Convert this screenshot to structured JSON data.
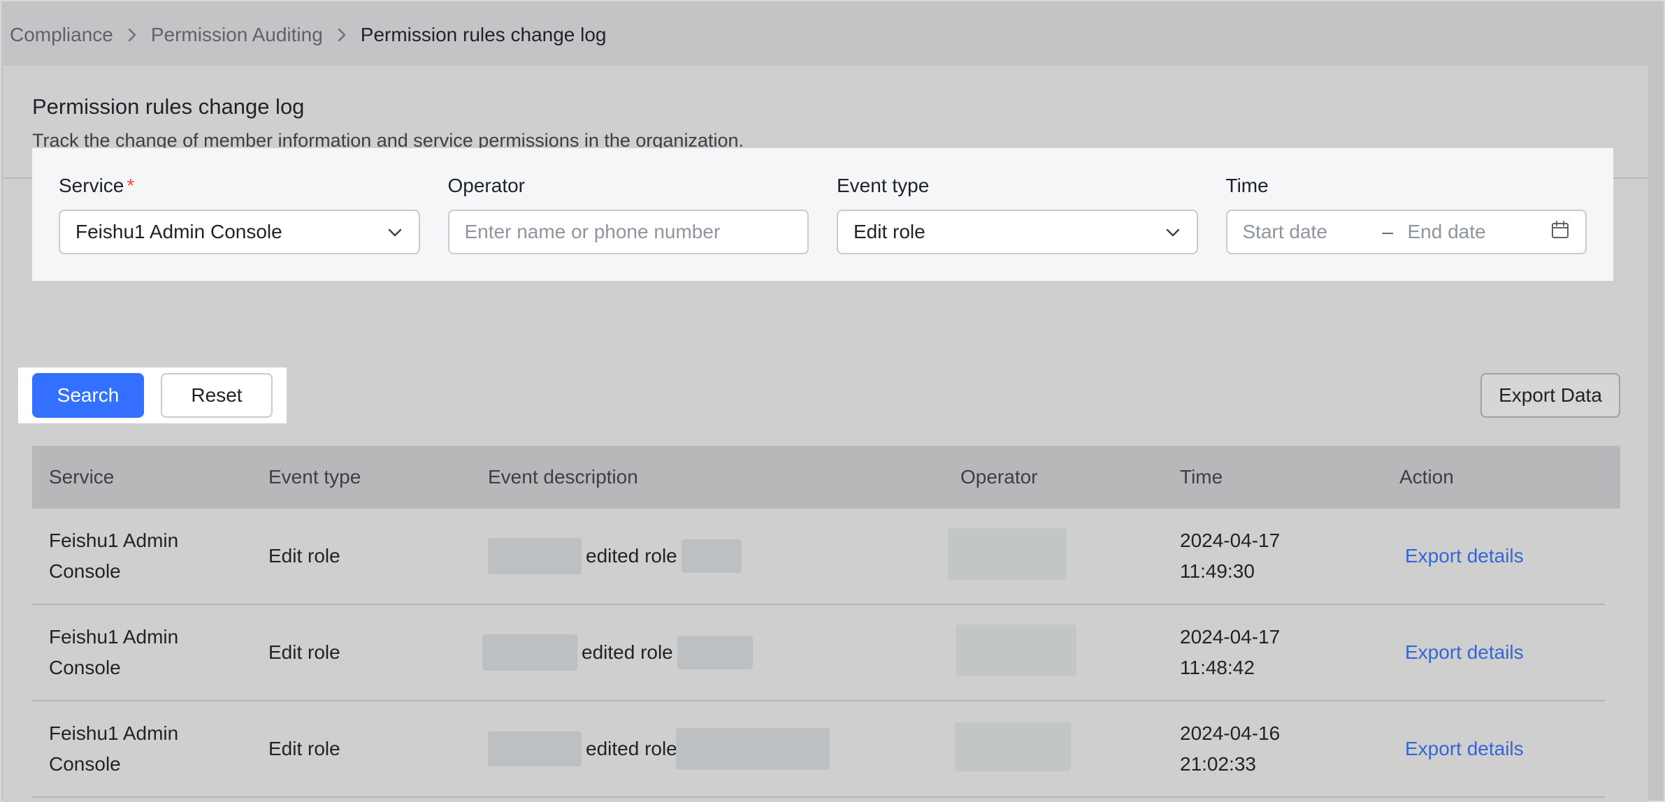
{
  "breadcrumb": {
    "items": [
      "Compliance",
      "Permission Auditing",
      "Permission rules change log"
    ]
  },
  "header": {
    "title": "Permission rules change log",
    "description": "Track the change of member information and service permissions in the organization."
  },
  "filters": {
    "service": {
      "label": "Service",
      "required_mark": "*",
      "value": "Feishu1 Admin Console"
    },
    "operator": {
      "label": "Operator",
      "placeholder": "Enter name or phone number",
      "value": ""
    },
    "event_type": {
      "label": "Event type",
      "value": "Edit role"
    },
    "time": {
      "label": "Time",
      "start_placeholder": "Start date",
      "separator": "–",
      "end_placeholder": "End date"
    }
  },
  "actions": {
    "search_label": "Search",
    "reset_label": "Reset",
    "export_label": "Export Data"
  },
  "table": {
    "columns": [
      "Service",
      "Event type",
      "Event description",
      "Operator",
      "Time",
      "Action"
    ],
    "rows": [
      {
        "service_line1": "Feishu1 Admin",
        "service_line2": "Console",
        "event_type": "Edit role",
        "description": "edited role",
        "date": "2024-04-17",
        "time": "11:49:30",
        "action": "Export details"
      },
      {
        "service_line1": "Feishu1 Admin",
        "service_line2": "Console",
        "event_type": "Edit role",
        "description": "edited role",
        "date": "2024-04-17",
        "time": "11:48:42",
        "action": "Export details"
      },
      {
        "service_line1": "Feishu1 Admin",
        "service_line2": "Console",
        "event_type": "Edit role",
        "description": "edited role",
        "date": "2024-04-16",
        "time": "21:02:33",
        "action": "Export details"
      }
    ]
  },
  "icons": {
    "breadcrumb_separator": "chevron-right-icon",
    "dropdown": "chevron-down-icon",
    "date_picker": "calendar-icon"
  },
  "colors": {
    "primary": "#3370ff",
    "link": "#3566d6",
    "required": "#f54a45"
  }
}
